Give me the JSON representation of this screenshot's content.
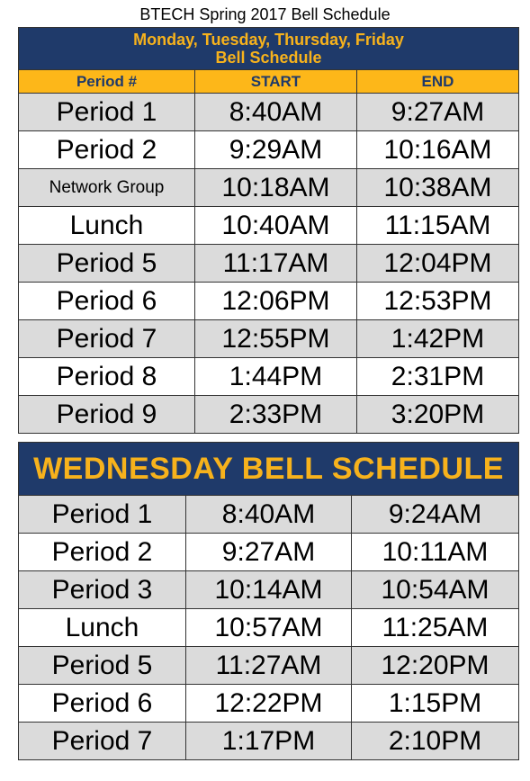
{
  "title": "BTECH Spring 2017 Bell Schedule",
  "schedule_a": {
    "banner_line1": "Monday, Tuesday, Thursday, Friday",
    "banner_line2": "Bell Schedule",
    "headers": [
      "Period #",
      "START",
      "END"
    ],
    "rows": [
      [
        "Period 1",
        "8:40AM",
        "9:27AM"
      ],
      [
        "Period 2",
        "9:29AM",
        "10:16AM"
      ],
      [
        "Network Group",
        "10:18AM",
        "10:38AM"
      ],
      [
        "Lunch",
        "10:40AM",
        "11:15AM"
      ],
      [
        "Period 5",
        "11:17AM",
        "12:04PM"
      ],
      [
        "Period 6",
        "12:06PM",
        "12:53PM"
      ],
      [
        "Period 7",
        "12:55PM",
        "1:42PM"
      ],
      [
        "Period 8",
        "1:44PM",
        "2:31PM"
      ],
      [
        "Period 9",
        "2:33PM",
        "3:20PM"
      ]
    ]
  },
  "schedule_b": {
    "banner": "WEDNESDAY BELL SCHEDULE",
    "rows": [
      [
        "Period 1",
        "8:40AM",
        "9:24AM"
      ],
      [
        "Period 2",
        "9:27AM",
        "10:11AM"
      ],
      [
        "Period 3",
        "10:14AM",
        "10:54AM"
      ],
      [
        "Lunch",
        "10:57AM",
        "11:25AM"
      ],
      [
        "Period 5",
        "11:27AM",
        "12:20PM"
      ],
      [
        "Period 6",
        "12:22PM",
        "1:15PM"
      ],
      [
        "Period 7",
        "1:17PM",
        "2:10PM"
      ]
    ]
  },
  "colors": {
    "navy": "#1f3a6a",
    "gold": "#fdb719",
    "row_shade": "#dbdbdb"
  }
}
